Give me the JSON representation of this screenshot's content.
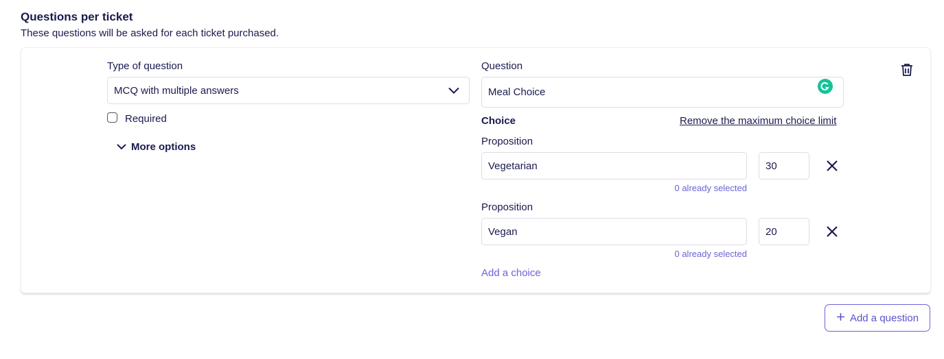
{
  "section": {
    "title": "Questions per ticket",
    "subtitle": "These questions will be asked for each ticket purchased."
  },
  "question_card": {
    "type_label": "Type of question",
    "type_value": "MCQ with multiple answers",
    "required_label": "Required",
    "more_options_label": "More options",
    "question_label": "Question",
    "question_value": "Meal Choice",
    "choice_heading": "Choice",
    "remove_limit_link": "Remove the maximum choice limit",
    "propositions": [
      {
        "label": "Proposition",
        "value": "Vegetarian",
        "limit": "30",
        "helper": "0 already selected"
      },
      {
        "label": "Proposition",
        "value": "Vegan",
        "limit": "20",
        "helper": "0 already selected"
      }
    ],
    "add_choice_label": "Add a choice",
    "delete_icon": "trash-icon"
  },
  "footer": {
    "add_question_label": "Add a question",
    "add_question_icon": "plus-icon"
  },
  "colors": {
    "accent": "#6b63d6",
    "text_primary": "#1a1a4e",
    "border": "#dcdce4",
    "grammarly": "#15c39a"
  }
}
